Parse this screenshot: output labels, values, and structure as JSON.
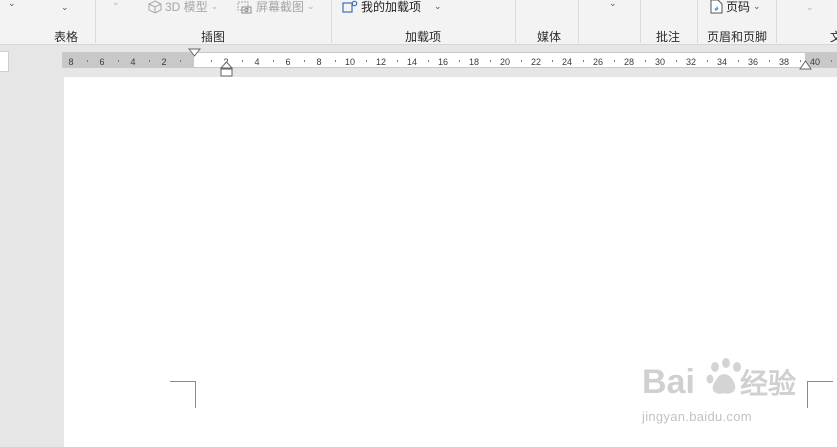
{
  "ribbon": {
    "controls": {
      "model3d": "3D 模型",
      "screenshot": "屏幕截图",
      "my_addins": "我的加载项",
      "page_number": "页码"
    },
    "groups": {
      "table": "表格",
      "illustrations": "插图",
      "addins": "加载项",
      "media": "媒体",
      "comments": "批注",
      "header_footer": "页眉和页脚",
      "text_partial": "文"
    }
  },
  "ruler": {
    "ticks": [
      "8",
      "6",
      "4",
      "2",
      "2",
      "4",
      "6",
      "8",
      "10",
      "12",
      "14",
      "16",
      "18",
      "20",
      "22",
      "24",
      "26",
      "28",
      "30",
      "32",
      "34",
      "36",
      "38",
      "40"
    ]
  },
  "watermark": {
    "brand": "Bai",
    "brand_cn": "经验",
    "url": "jingyan.baidu.com"
  }
}
